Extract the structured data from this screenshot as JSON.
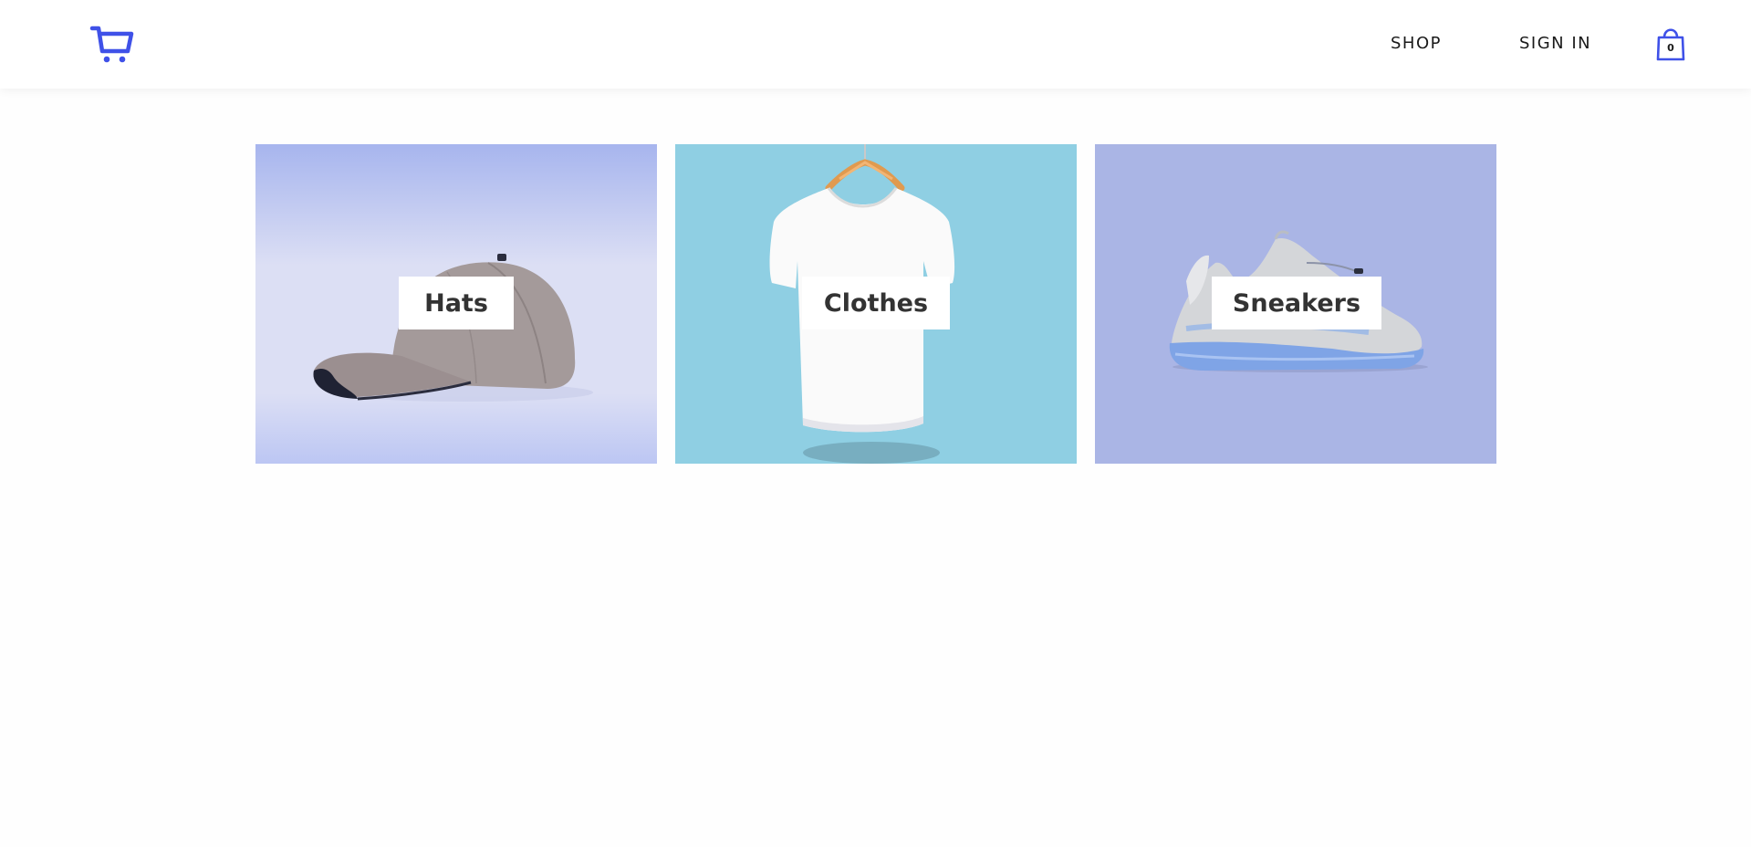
{
  "header": {
    "logo_icon": "shopping-cart-icon",
    "nav": {
      "shop_label": "SHOP",
      "signin_label": "SIGN IN"
    },
    "bag": {
      "icon": "shopping-bag-icon",
      "count": "0"
    }
  },
  "categories": [
    {
      "label": "Hats",
      "image": "baseball-cap-image"
    },
    {
      "label": "Clothes",
      "image": "white-tshirt-image"
    },
    {
      "label": "Sneakers",
      "image": "sneaker-image"
    }
  ],
  "colors": {
    "brand": "#3f51e8",
    "hats_bg": "#dcdff4",
    "clothes_bg": "#8fcfe3",
    "sneakers_bg": "#aab5e5",
    "text": "#333333"
  }
}
